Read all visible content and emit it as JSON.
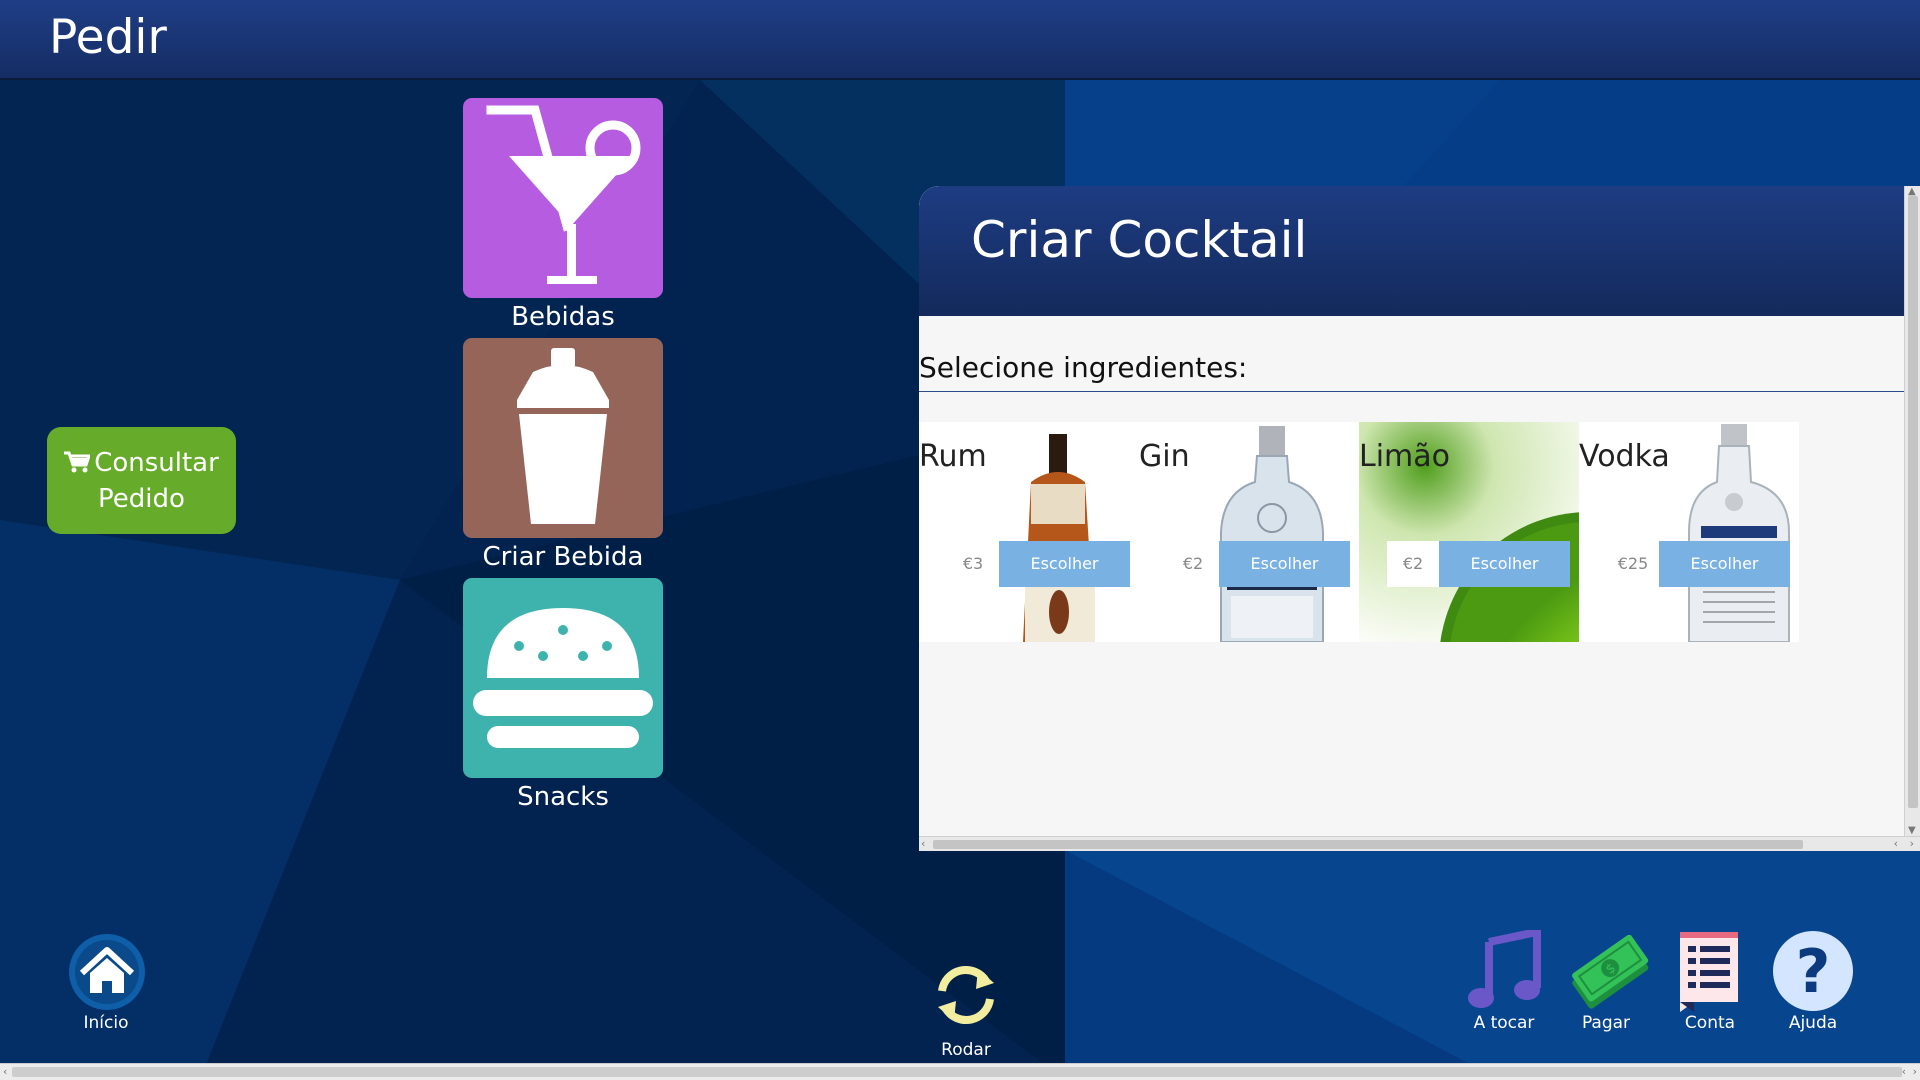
{
  "header": {
    "title": "Pedir"
  },
  "categories": [
    {
      "label": "Bebidas",
      "icon": "cocktail-glass-icon",
      "color": "#b65ce0"
    },
    {
      "label": "Criar Bebida",
      "icon": "shaker-icon",
      "color": "#95655a"
    },
    {
      "label": "Snacks",
      "icon": "burger-icon",
      "color": "#3eb3ad"
    }
  ],
  "consult": {
    "label_line1": "Consultar",
    "label_line2": "Pedido",
    "icon": "cart-icon",
    "color": "#66ac2a"
  },
  "panel": {
    "title": "Criar Cocktail",
    "select_label": "Selecione ingredientes:",
    "ingredients": [
      {
        "name": "Rum",
        "price": "€3",
        "button": "Escolher"
      },
      {
        "name": "Gin",
        "price": "€2",
        "button": "Escolher"
      },
      {
        "name": "Limão",
        "price": "€2",
        "button": "Escolher"
      },
      {
        "name": "Vodka",
        "price": "€25",
        "button": "Escolher"
      }
    ],
    "button_color": "#79b1e3"
  },
  "bottom": {
    "home": {
      "label": "Início",
      "icon": "home-icon"
    },
    "rotate": {
      "label": "Rodar",
      "icon": "rotate-icon"
    },
    "music": {
      "label": "A tocar",
      "icon": "music-note-icon"
    },
    "pay": {
      "label": "Pagar",
      "icon": "money-icon"
    },
    "bill": {
      "label": "Conta",
      "icon": "receipt-icon"
    },
    "help": {
      "label": "Ajuda",
      "icon": "help-icon"
    }
  }
}
